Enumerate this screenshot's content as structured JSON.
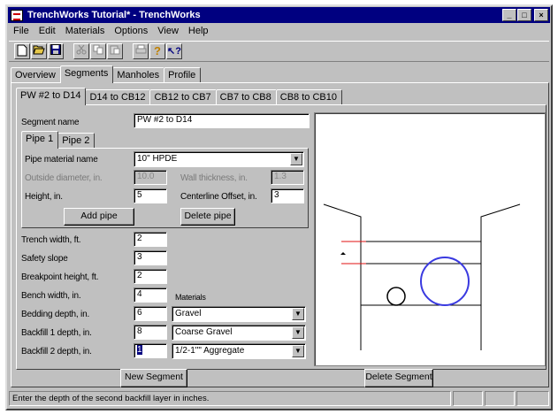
{
  "window": {
    "title": "TrenchWorks Tutorial* - TrenchWorks",
    "minimize": "_",
    "maximize": "□",
    "close": "×"
  },
  "menu": [
    "File",
    "Edit",
    "Materials",
    "Options",
    "View",
    "Help"
  ],
  "toolbar": {
    "icons": [
      "new-icon",
      "open-icon",
      "save-icon",
      "cut-icon",
      "copy-icon",
      "paste-icon",
      "print-icon",
      "help-icon",
      "context-help-icon"
    ]
  },
  "main_tabs": [
    "Overview",
    "Segments",
    "Manholes",
    "Profile"
  ],
  "segment_tabs": [
    "PW #2 to D14",
    "D14 to CB12",
    "CB12 to CB7",
    "CB7 to CB8",
    "CB8 to CB10"
  ],
  "segment": {
    "name_label": "Segment name",
    "name_value": "PW #2 to D14"
  },
  "pipe_tabs": [
    "Pipe 1",
    "Pipe 2"
  ],
  "pipe": {
    "material_label": "Pipe material name",
    "material_value": "10\" HPDE",
    "od_label": "Outside diameter, in.",
    "od_value": "10.0",
    "wall_label": "Wall thickness, in.",
    "wall_value": "1.3",
    "height_label": "Height, in.",
    "height_value": "5",
    "offset_label": "Centerline Offset, in.",
    "offset_value": "3",
    "add_label": "Add pipe",
    "delete_label": "Delete pipe"
  },
  "trench": {
    "width_label": "Trench width, ft.",
    "width_value": "2",
    "slope_label": "Safety slope",
    "slope_value": "3",
    "breakpoint_label": "Breakpoint height, ft.",
    "breakpoint_value": "2",
    "bench_label": "Bench width, in.",
    "bench_value": "4",
    "materials_label": "Materials",
    "bedding_label": "Bedding depth, in.",
    "bedding_value": "6",
    "bedding_material": "Gravel",
    "backfill1_label": "Backfill 1 depth, in.",
    "backfill1_value": "8",
    "backfill1_material": "Coarse Gravel",
    "backfill2_label": "Backfill 2 depth, in.",
    "backfill2_value": "1",
    "backfill2_material": "1/2-1\"\" Aggregate"
  },
  "buttons": {
    "new_segment": "New Segment",
    "delete_segment": "Delete Segment"
  },
  "status": {
    "message": "Enter the depth of the second backfill layer in inches."
  },
  "colors": {
    "title_bar": "#000080",
    "large_pipe": "#3a3ae0",
    "red_marks": "#e01010"
  }
}
